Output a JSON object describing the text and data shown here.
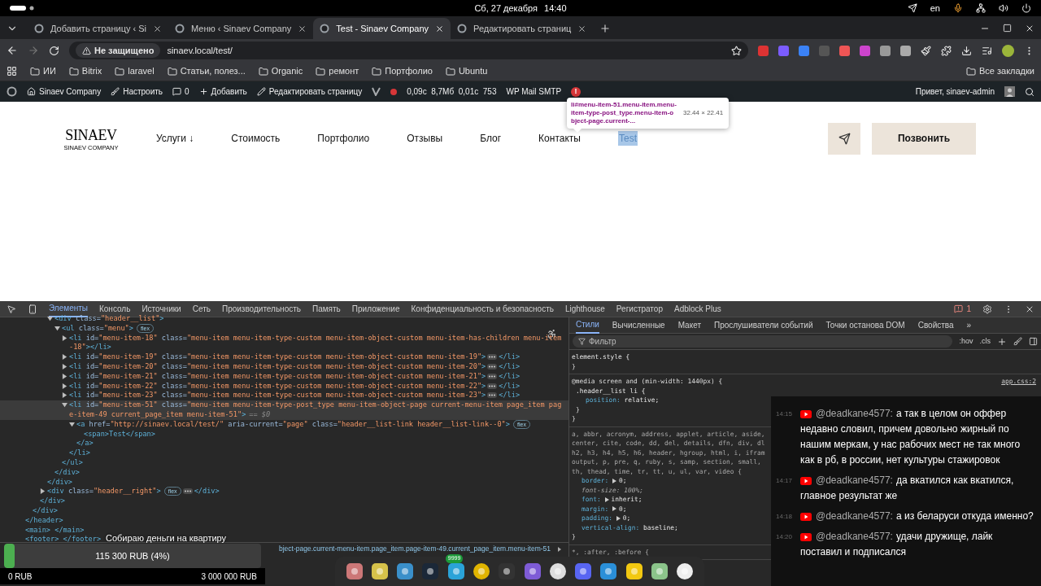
{
  "system_bar": {
    "date": "Сб, 27 декабря",
    "time": "14:40",
    "language": "en"
  },
  "tabs": [
    {
      "title": "Добавить страницу ‹ Si",
      "selected": false
    },
    {
      "title": "Меню ‹ Sinaev Company",
      "selected": false
    },
    {
      "title": "Test - Sinaev Company",
      "selected": true
    },
    {
      "title": "Редактировать страниц",
      "selected": false
    }
  ],
  "address_bar": {
    "security": "Не защищено",
    "url": "sinaev.local/test/"
  },
  "bookmarks": [
    "ИИ",
    "Bitrix",
    "laravel",
    "Статьи, полез...",
    "Organic",
    "ремонт",
    "Портфолио",
    "Ubuntu"
  ],
  "all_bookmarks": "Все закладки",
  "admin_bar": {
    "site": "Sinaev Company",
    "customize": "Настроить",
    "comments": "0",
    "add": "Добавить",
    "edit": "Редактировать страницу",
    "stats": "0,09с  8,7Мб  0,01с  753",
    "smtp": "WP Mail SMTP",
    "smtp_alert": "!",
    "greeting": "Привет, sinaev-admin"
  },
  "site": {
    "logo": "SINAEV",
    "logo_sub": "SINAEV COMPANY",
    "call": "Позвонить",
    "nav": [
      {
        "label": "Услуги ↓",
        "selected": false
      },
      {
        "label": "Стоимость",
        "selected": false
      },
      {
        "label": "Портфолио",
        "selected": false
      },
      {
        "label": "Отзывы",
        "selected": false
      },
      {
        "label": "Блог",
        "selected": false
      },
      {
        "label": "Контакты",
        "selected": false
      },
      {
        "label": "Test",
        "selected": true
      }
    ]
  },
  "inspect_tooltip": {
    "selector": "li#menu-item-51.menu-item.menu-item-type-post_type.menu-item-object-page.current-...",
    "size": "32.44 × 22.41"
  },
  "devtools": {
    "tabs": [
      {
        "label": "Элементы",
        "selected": true
      },
      {
        "label": "Консоль",
        "selected": false
      },
      {
        "label": "Источники",
        "selected": false
      },
      {
        "label": "Сеть",
        "selected": false
      },
      {
        "label": "Производительность",
        "selected": false
      },
      {
        "label": "Память",
        "selected": false
      },
      {
        "label": "Приложение",
        "selected": false
      },
      {
        "label": "Конфиденциальность и безопасность",
        "selected": false
      },
      {
        "label": "Lighthouse",
        "selected": false
      },
      {
        "label": "Регистратор",
        "selected": false
      },
      {
        "label": "Adblock Plus",
        "selected": false
      }
    ],
    "issues": "1",
    "tree": [
      {
        "close": "</header>",
        "children": [
          {
            "close": "</div>",
            "children": [
              {
                "close": "</div>",
                "children": [
                  {
                    "close": "</div>",
                    "children": [
                      {
                        "tag": "<div class=\"header__list\">",
                        "expanded": true,
                        "close": "</div>",
                        "children": [
                          {
                            "tag": "<ul class=\"menu\">",
                            "badge": "flex",
                            "expanded": true,
                            "close": "</ul>",
                            "children": [
                              {
                                "tag": "<li id=\"menu-item-18\" class=\"menu-item menu-item-type-custom menu-item-object-custom menu-item-has-children menu-item-18\">",
                                "expanded": false,
                                "ellipsis": false,
                                "close": "</li>"
                              },
                              {
                                "tag": "<li id=\"menu-item-19\" class=\"menu-item menu-item-type-custom menu-item-object-custom menu-item-19\">",
                                "expanded": false,
                                "ellipsis": true,
                                "close": "</li>"
                              },
                              {
                                "tag": "<li id=\"menu-item-20\" class=\"menu-item menu-item-type-custom menu-item-object-custom menu-item-20\">",
                                "expanded": false,
                                "ellipsis": true,
                                "close": "</li>"
                              },
                              {
                                "tag": "<li id=\"menu-item-21\" class=\"menu-item menu-item-type-custom menu-item-object-custom menu-item-21\">",
                                "expanded": false,
                                "ellipsis": true,
                                "close": "</li>"
                              },
                              {
                                "tag": "<li id=\"menu-item-22\" class=\"menu-item menu-item-type-custom menu-item-object-custom menu-item-22\">",
                                "expanded": false,
                                "ellipsis": true,
                                "close": "</li>"
                              },
                              {
                                "tag": "<li id=\"menu-item-23\" class=\"menu-item menu-item-type-custom menu-item-object-custom menu-item-23\">",
                                "expanded": false,
                                "ellipsis": true,
                                "close": "</li>"
                              },
                              {
                                "tag": "<li id=\"menu-item-51\" class=\"menu-item menu-item-type-post_type menu-item-object-page current-menu-item page_item page-item-49 current_page_item menu-item-51\">",
                                "expanded": true,
                                "selected": true,
                                "suffix": "== $0",
                                "close": "</li>",
                                "children": [
                                  {
                                    "tag": "<a href=\"http://sinaev.local/test/\" aria-current=\"page\" class=\"header__list-link header__list-link--0\">",
                                    "badge": "flex",
                                    "expanded": true,
                                    "close": "</a>",
                                    "children": [
                                      {
                                        "tag": "<span>Test</span>"
                                      }
                                    ]
                                  }
                                ]
                              }
                            ]
                          }
                        ]
                      }
                    ]
                  },
                  {
                    "tag": "<div class=\"header__right\">",
                    "badge": "flex",
                    "expanded": false,
                    "ellipsis": true,
                    "close": "</div>"
                  }
                ]
              }
            ]
          }
        ]
      },
      {
        "tag": "<main> </main>"
      },
      {
        "tag": "<footer> </footer>"
      }
    ],
    "breadcrumb": "bject-page.current-menu-item.page_item.page-item-49.current_page_item.menu-item-51",
    "style_tabs": [
      {
        "label": "Стили",
        "selected": true
      },
      {
        "label": "Вычисленные",
        "selected": false
      },
      {
        "label": "Макет",
        "selected": false
      },
      {
        "label": "Прослушиватели событий",
        "selected": false
      },
      {
        "label": "Точки останова DOM",
        "selected": false
      },
      {
        "label": "Свойства",
        "selected": false
      }
    ],
    "more_tabs": "»",
    "filter_placeholder": "Фильтр",
    "hov": ":hov",
    "cls": ".cls",
    "rules": [
      {
        "selector_lines": [
          "element.style {"
        ],
        "close": "}"
      },
      {
        "media": "@media screen and (min-width: 1440px) {",
        "selector_lines": [
          ".header__list li {"
        ],
        "source": "app.css:2",
        "close": "}",
        "media_close": "}",
        "declarations": [
          {
            "prop": "position:",
            "value": "relative;",
            "expandable": false,
            "overridden": false
          }
        ]
      },
      {
        "selector_lines": [
          "a, abbr, acronym, address, applet, article, aside,",
          "center, cite, code, dd, del, details, dfn, div, dl",
          "h2, h3, h4, h5, h6, header, hgroup, html, i, ifram",
          "output, p, pre, q, ruby, s, samp, section, small,",
          "th, thead, time, tr, tt, u, ul, var, video {"
        ],
        "close": "}",
        "declarations": [
          {
            "prop": "border:",
            "value": "0;",
            "expandable": true,
            "overridden": false
          },
          {
            "prop": "font-size:",
            "value": "100%;",
            "expandable": false,
            "overridden": true
          },
          {
            "prop": "font:",
            "value": "inherit;",
            "expandable": true,
            "overridden": false
          },
          {
            "prop": "margin:",
            "value": "0;",
            "expandable": true,
            "overridden": false
          },
          {
            "prop": "padding:",
            "value": "0;",
            "expandable": true,
            "overridden": false
          },
          {
            "prop": "vertical-align:",
            "value": "baseline;",
            "expandable": false,
            "overridden": false
          }
        ]
      },
      {
        "selector_lines": [
          "*, :after, :before {"
        ]
      }
    ]
  },
  "chat": [
    {
      "time": "14:15",
      "author": "@deadkane4577:",
      "text": "а так в целом он оффер недавно словил, причем довольно жирный по нашим меркам, у нас рабочих мест не так много как в рб, в россии, нет культуры стажировок"
    },
    {
      "time": "14:17",
      "author": "@deadkane4577:",
      "text": "да вкатился как вкатился, главное результат же"
    },
    {
      "time": "14:18",
      "author": "@deadkane4577:",
      "text": "а из беларуси откуда именно?"
    },
    {
      "time": "14:20",
      "author": "@deadkane4577:",
      "text": "удачи дружище, лайк поставил и подписался"
    }
  ],
  "donation": {
    "title": "Собираю деньги на квартиру",
    "amount": "115 300 RUB (4%)",
    "level": 0.04,
    "min": "0 RUB",
    "max": "3 000 000 RUB"
  },
  "dock": {
    "badge": "9999"
  }
}
